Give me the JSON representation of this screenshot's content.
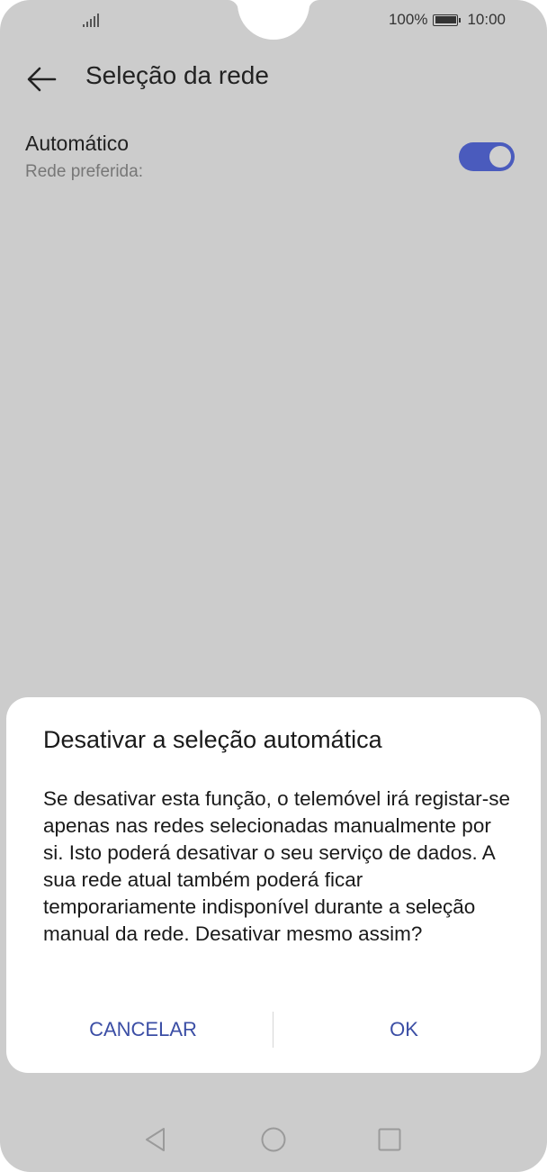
{
  "status_bar": {
    "battery_percent": "100%",
    "time": "10:00",
    "icons": [
      "signal-icon",
      "battery-icon"
    ]
  },
  "header": {
    "title": "Seleção da rede",
    "back_icon": "arrow-left-icon"
  },
  "setting": {
    "title": "Automático",
    "subtitle": "Rede preferida:",
    "toggle_on": true,
    "toggle_color": "#4a5bbd"
  },
  "dialog": {
    "title": "Desativar a seleção automática",
    "body": "Se desativar esta função, o telemóvel irá registar-se apenas nas redes selecionadas manualmente por si. Isto poderá desativar o seu serviço de dados. A sua rede atual também poderá ficar temporariamente indisponível durante a seleção manual da rede. Desativar mesmo assim?",
    "cancel_label": "CANCELAR",
    "ok_label": "OK",
    "button_color": "#3b4ea5"
  },
  "nav_bar": {
    "icons": [
      "nav-back-icon",
      "nav-home-icon",
      "nav-recent-icon"
    ]
  }
}
